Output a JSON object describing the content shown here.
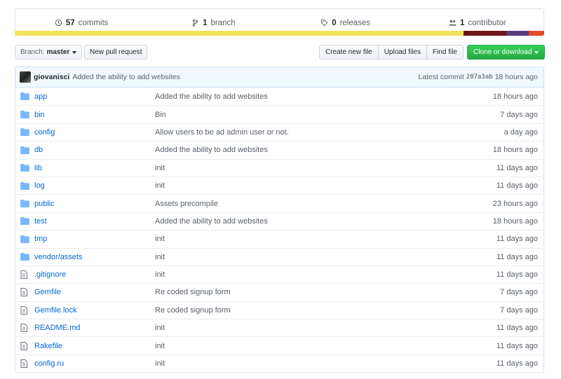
{
  "summary": {
    "commits_count": "57",
    "commits_label": "commits",
    "branch_count": "1",
    "branch_label": "branch",
    "releases_count": "0",
    "releases_label": "releases",
    "contributors_count": "1",
    "contributors_label": "contributor"
  },
  "language_bar": [
    {
      "color": "#f1e05a",
      "fraction": 0.848
    },
    {
      "color": "#701516",
      "fraction": 0.081
    },
    {
      "color": "#563d7c",
      "fraction": 0.042
    },
    {
      "color": "#e34c26",
      "fraction": 0.029
    }
  ],
  "toolbar": {
    "branch_prefix": "Branch:",
    "branch_name": "master",
    "new_pull_request": "New pull request",
    "create_new_file": "Create new file",
    "upload_files": "Upload files",
    "find_file": "Find file",
    "clone_or_download": "Clone or download"
  },
  "latest_commit": {
    "author": "giovanisci",
    "message": "Added the ability to add websites",
    "label": "Latest commit",
    "sha": "207a3ab",
    "age": "18 hours ago"
  },
  "files": [
    {
      "type": "dir",
      "name": "app",
      "message": "Added the ability to add websites",
      "age": "18 hours ago"
    },
    {
      "type": "dir",
      "name": "bin",
      "message": "Bin",
      "age": "7 days ago"
    },
    {
      "type": "dir",
      "name": "config",
      "message": "Allow users to be ad admin user or not.",
      "age": "a day ago"
    },
    {
      "type": "dir",
      "name": "db",
      "message": "Added the ability to add websites",
      "age": "18 hours ago"
    },
    {
      "type": "dir",
      "name": "lib",
      "message": "init",
      "age": "11 days ago"
    },
    {
      "type": "dir",
      "name": "log",
      "message": "init",
      "age": "11 days ago"
    },
    {
      "type": "dir",
      "name": "public",
      "message": "Assets precompile",
      "age": "23 hours ago"
    },
    {
      "type": "dir",
      "name": "test",
      "message": "Added the ability to add websites",
      "age": "18 hours ago"
    },
    {
      "type": "dir",
      "name": "tmp",
      "message": "init",
      "age": "11 days ago"
    },
    {
      "type": "dir",
      "name": "vendor/assets",
      "message": "init",
      "age": "11 days ago"
    },
    {
      "type": "file",
      "name": ".gitignore",
      "message": "init",
      "age": "11 days ago"
    },
    {
      "type": "file",
      "name": "Gemfile",
      "message": "Re coded signup form",
      "age": "7 days ago"
    },
    {
      "type": "file",
      "name": "Gemfile.lock",
      "message": "Re coded signup form",
      "age": "7 days ago"
    },
    {
      "type": "file",
      "name": "README.md",
      "message": "init",
      "age": "11 days ago"
    },
    {
      "type": "file",
      "name": "Rakefile",
      "message": "init",
      "age": "11 days ago"
    },
    {
      "type": "file",
      "name": "config.ru",
      "message": "init",
      "age": "11 days ago"
    }
  ]
}
